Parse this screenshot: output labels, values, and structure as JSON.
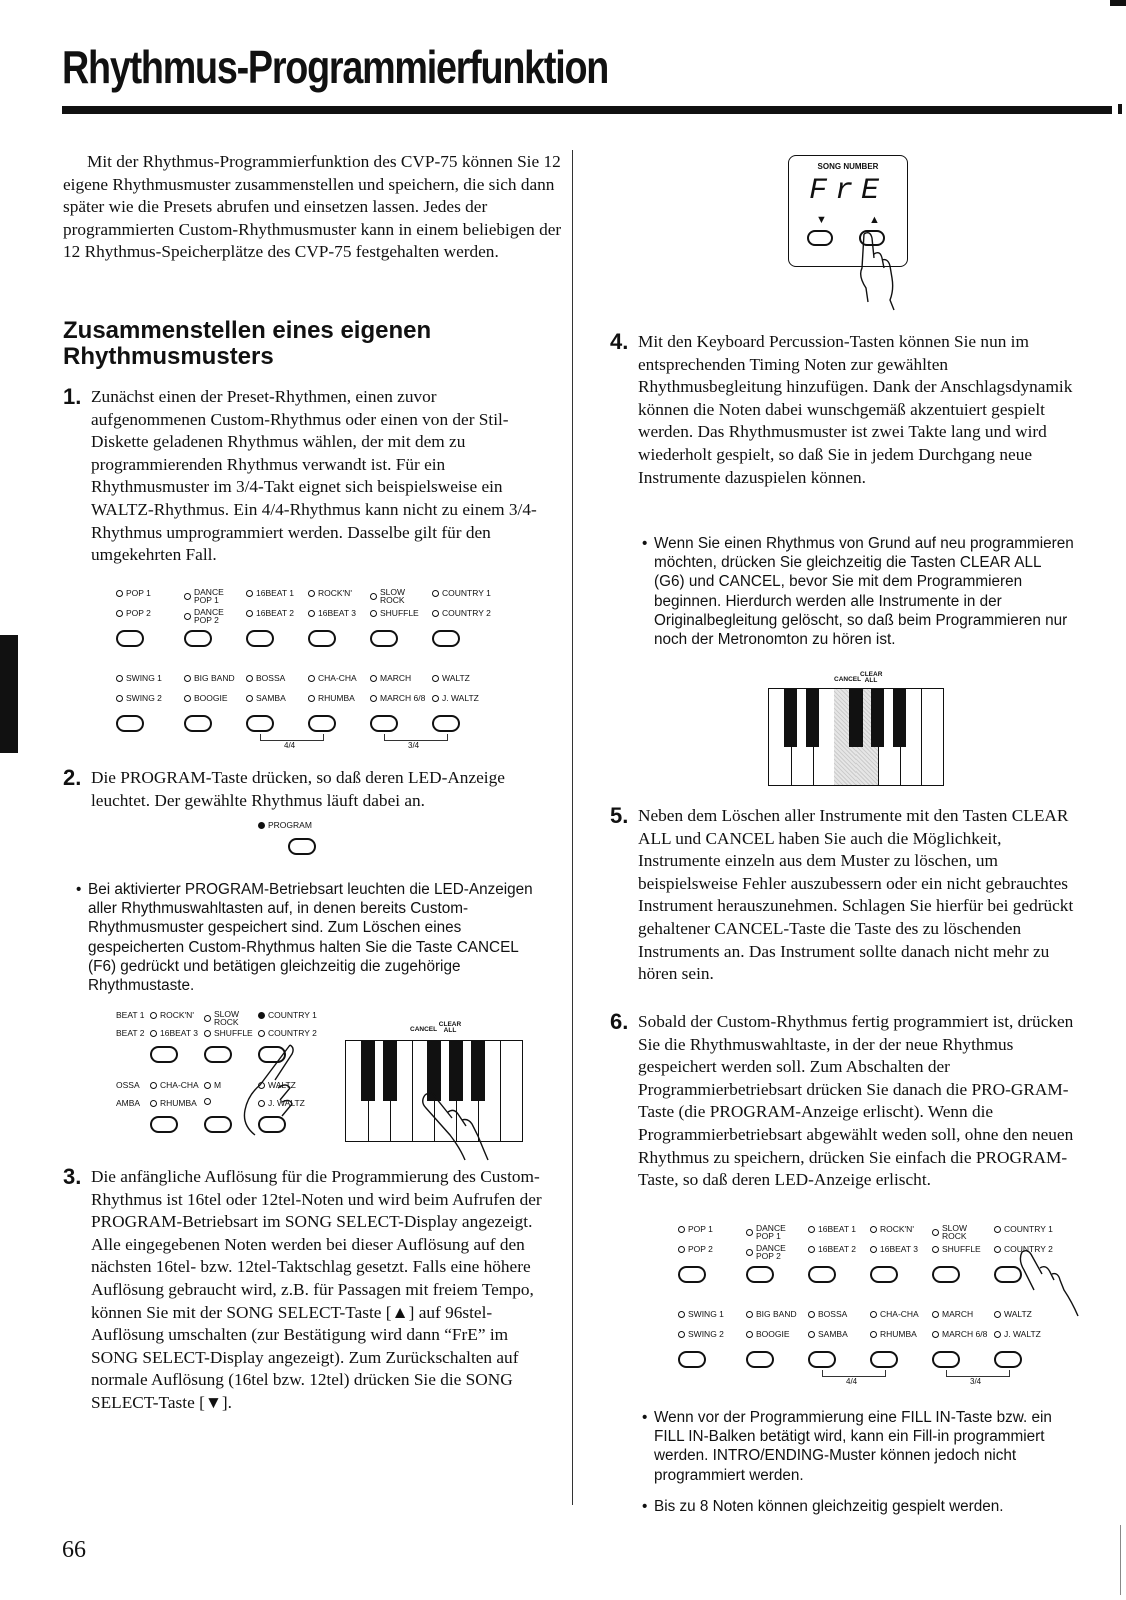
{
  "page": {
    "title": "Rhythmus-Programmierfunktion",
    "page_number": "66"
  },
  "intro": "Mit der Rhythmus-Programmierfunktion des CVP-75 können Sie 12 eigene Rhythmusmuster zusammenstellen und speichern, die sich dann später wie die Presets abrufen und einsetzen lassen. Jedes der programmierten Custom-Rhythmusmuster kann in einem beliebigen der 12 Rhythmus-Speicherplätze des CVP-75 festgehalten werden.",
  "section_heading": "Zusammenstellen eines eigenen Rhythmusmusters",
  "steps": [
    {
      "num": "1.",
      "text": "Zunächst einen der Preset-Rhythmen, einen zuvor aufgenommenen Custom-Rhythmus oder einen von der Stil-Diskette geladenen Rhythmus wählen, der mit dem zu programmierenden Rhythmus verwandt ist. Für ein Rhythmusmuster im 3/4-Takt eignet sich beispielsweise ein WALTZ-Rhythmus. Ein 4/4-Rhythmus kann nicht zu einem 3/4-Rhythmus umprogrammiert werden. Dasselbe gilt für den umgekehrten Fall."
    },
    {
      "num": "2.",
      "text": "Die PROGRAM-Taste drücken, so daß deren LED-Anzeige leuchtet. Der gewählte Rhythmus läuft dabei an."
    },
    {
      "num": "3.",
      "text": "Die anfängliche Auflösung für die Programmierung des Custom-Rhythmus ist 16tel oder 12tel-Noten und wird beim Aufrufen der PROGRAM-Betriebsart im SONG SELECT-Display angezeigt. Alle eingegebenen Noten werden bei dieser Auflösung auf den nächsten 16tel- bzw. 12tel-Taktschlag gesetzt. Falls eine höhere Auflösung gebraucht wird, z.B. für Passagen mit freiem Tempo, können Sie mit der SONG SELECT-Taste [▲] auf 96stel-Auflösung umschalten (zur Bestätigung wird dann “FrE” im SONG SELECT-Display angezeigt). Zum Zurückschalten auf normale Auflösung (16tel bzw. 12tel) drücken Sie die SONG SELECT-Taste [▼]."
    },
    {
      "num": "4.",
      "text": "Mit den Keyboard Percussion-Tasten können Sie nun im entsprechenden Timing Noten zur gewählten Rhythmusbegleitung hinzufügen. Dank der Anschlagsdynamik können die Noten dabei wunschgemäß akzentuiert gespielt werden. Das Rhythmusmuster ist zwei Takte lang und wird wiederholt gespielt, so daß Sie in jedem Durchgang neue Instrumente dazuspielen können."
    },
    {
      "num": "5.",
      "text": "Neben dem Löschen aller Instrumente mit den Tasten CLEAR ALL und CANCEL haben Sie auch die Möglichkeit, Instrumente einzeln aus dem Muster zu löschen, um beispielsweise Fehler auszubessern oder ein nicht gebrauchtes Instrument herauszunehmen. Schlagen Sie hierfür bei gedrückt gehaltener CANCEL-Taste die Taste des zu löschenden Instruments an. Das Instrument sollte danach nicht mehr zu hören sein."
    },
    {
      "num": "6.",
      "text": "Sobald der Custom-Rhythmus fertig programmiert ist, drücken Sie die Rhythmuswahltaste, in der der neue Rhythmus gespeichert werden soll. Zum Abschalten der Programmierbetriebsart drücken Sie danach die PRO-GRAM-Taste (die PROGRAM-Anzeige erlischt). Wenn die Programmierbetriebsart abgewählt weden soll, ohne den neuen Rhythmus zu speichern, drücken Sie einfach die PROGRAM-Taste, so daß deren LED-Anzeige erlischt."
    }
  ],
  "notes": {
    "program_mode": "Bei aktivierter PROGRAM-Betriebsart leuchten die LED-Anzeigen aller Rhythmuswahltasten auf, in denen bereits Custom-Rhythmusmuster gespeichert sind. Zum Löschen eines gespeicherten Custom-Rhythmus halten Sie die Taste CANCEL (F6) gedrückt und betätigen gleichzeitig die zugehörige Rhythmustaste.",
    "clear_all": "Wenn Sie einen Rhythmus von Grund auf neu programmieren möchten, drücken Sie gleichzeitig die Tasten CLEAR ALL (G6) und CANCEL, bevor Sie mit dem Programmieren beginnen. Hierdurch werden alle Instrumente in der Originalbegleitung gelöscht, so daß beim Programmieren nur noch der Metronomton zu hören ist.",
    "fill_in": "Wenn vor der Programmierung eine FILL IN-Taste bzw. ein FILL IN-Balken betätigt wird, kann ein Fill-in programmiert werden. INTRO/ENDING-Muster können jedoch nicht programmiert werden.",
    "polyphony": "Bis zu 8 Noten können gleichzeitig gespielt werden.",
    "bullet": "•"
  },
  "rhythm_panel": {
    "upper_row1": [
      "POP 1",
      "DANCE|POP 1",
      "16BEAT 1",
      "ROCK'N'",
      "SLOW|ROCK",
      "COUNTRY 1"
    ],
    "upper_row2": [
      "POP 2",
      "DANCE|POP 2",
      "16BEAT 2",
      "16BEAT 3",
      "SHUFFLE",
      "COUNTRY 2"
    ],
    "lower_row1": [
      "SWING 1",
      "BIG BAND",
      "BOSSA",
      "CHA-CHA",
      "MARCH",
      "WALTZ"
    ],
    "lower_row2": [
      "SWING 2",
      "BOOGIE",
      "SAMBA",
      "RHUMBA",
      "MARCH 6/8",
      "J. WALTZ"
    ],
    "group_4_4": "4/4",
    "group_3_4": "3/4"
  },
  "partial_panel": {
    "row1": [
      "BEAT 1",
      "ROCK'N'",
      "SLOW|ROCK",
      "COUNTRY 1"
    ],
    "row2": [
      "BEAT 2",
      "16BEAT 3",
      "SHUFFLE",
      "COUNTRY 2"
    ],
    "row3": [
      "OSSA",
      "CHA-CHA",
      "M",
      "WALTZ"
    ],
    "row4": [
      "AMBA",
      "RHUMBA",
      "",
      "J. WALTZ"
    ],
    "lit": "COUNTRY 1"
  },
  "program_button": {
    "label": "PROGRAM",
    "led": "on"
  },
  "song_display": {
    "label": "SONG NUMBER",
    "readout": "FrE",
    "down": "▼",
    "up": "▲"
  },
  "keyboard": {
    "cancel_label": "CANCEL",
    "clear_all_label": "CLEAR ALL"
  }
}
